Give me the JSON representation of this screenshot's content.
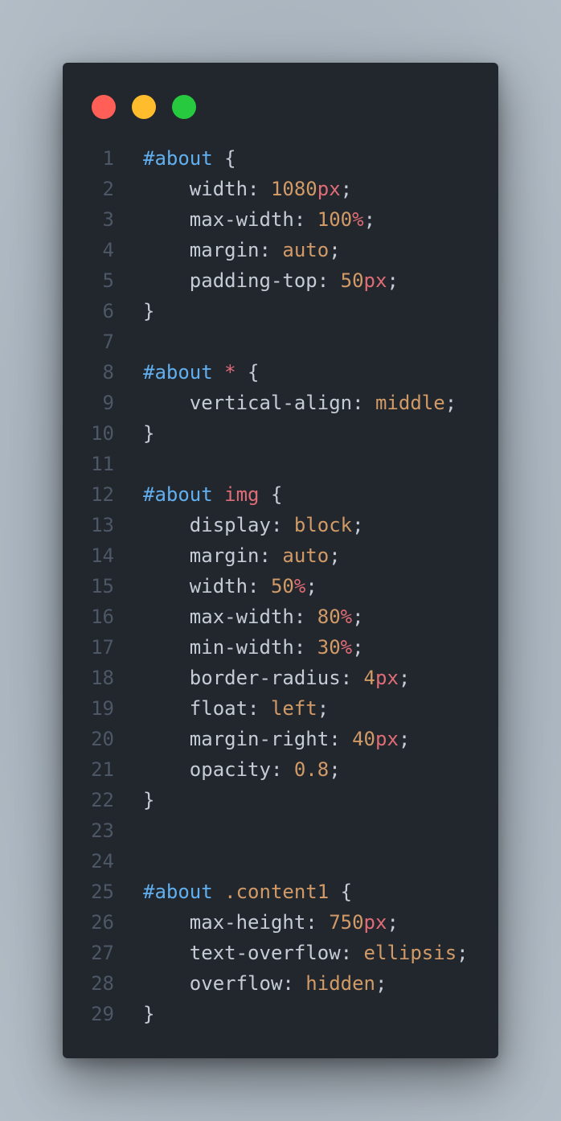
{
  "window": {
    "controls": [
      {
        "name": "close",
        "color": "#ff5f56"
      },
      {
        "name": "minimize",
        "color": "#ffbd2e"
      },
      {
        "name": "maximize",
        "color": "#27c93f"
      }
    ]
  },
  "code": {
    "lines": [
      [
        {
          "t": "sel-id",
          "v": "#about"
        },
        {
          "t": "punc",
          "v": " {"
        }
      ],
      [
        {
          "t": "prop",
          "v": "    width: "
        },
        {
          "t": "num",
          "v": "1080"
        },
        {
          "t": "unit",
          "v": "px"
        },
        {
          "t": "punc",
          "v": ";"
        }
      ],
      [
        {
          "t": "prop",
          "v": "    max-width: "
        },
        {
          "t": "num",
          "v": "100"
        },
        {
          "t": "unit",
          "v": "%"
        },
        {
          "t": "punc",
          "v": ";"
        }
      ],
      [
        {
          "t": "prop",
          "v": "    margin: "
        },
        {
          "t": "kw",
          "v": "auto"
        },
        {
          "t": "punc",
          "v": ";"
        }
      ],
      [
        {
          "t": "prop",
          "v": "    padding-top: "
        },
        {
          "t": "num",
          "v": "50"
        },
        {
          "t": "unit",
          "v": "px"
        },
        {
          "t": "punc",
          "v": ";"
        }
      ],
      [
        {
          "t": "punc",
          "v": "}"
        }
      ],
      [],
      [
        {
          "t": "sel-id",
          "v": "#about"
        },
        {
          "t": "punc",
          "v": " "
        },
        {
          "t": "sel-star",
          "v": "*"
        },
        {
          "t": "punc",
          "v": " {"
        }
      ],
      [
        {
          "t": "prop",
          "v": "    vertical-align: "
        },
        {
          "t": "kw",
          "v": "middle"
        },
        {
          "t": "punc",
          "v": ";"
        }
      ],
      [
        {
          "t": "punc",
          "v": "}"
        }
      ],
      [],
      [
        {
          "t": "sel-id",
          "v": "#about"
        },
        {
          "t": "punc",
          "v": " "
        },
        {
          "t": "sel-tag",
          "v": "img"
        },
        {
          "t": "punc",
          "v": " {"
        }
      ],
      [
        {
          "t": "prop",
          "v": "    display: "
        },
        {
          "t": "kw",
          "v": "block"
        },
        {
          "t": "punc",
          "v": ";"
        }
      ],
      [
        {
          "t": "prop",
          "v": "    margin: "
        },
        {
          "t": "kw",
          "v": "auto"
        },
        {
          "t": "punc",
          "v": ";"
        }
      ],
      [
        {
          "t": "prop",
          "v": "    width: "
        },
        {
          "t": "num",
          "v": "50"
        },
        {
          "t": "unit",
          "v": "%"
        },
        {
          "t": "punc",
          "v": ";"
        }
      ],
      [
        {
          "t": "prop",
          "v": "    max-width: "
        },
        {
          "t": "num",
          "v": "80"
        },
        {
          "t": "unit",
          "v": "%"
        },
        {
          "t": "punc",
          "v": ";"
        }
      ],
      [
        {
          "t": "prop",
          "v": "    min-width: "
        },
        {
          "t": "num",
          "v": "30"
        },
        {
          "t": "unit",
          "v": "%"
        },
        {
          "t": "punc",
          "v": ";"
        }
      ],
      [
        {
          "t": "prop",
          "v": "    border-radius: "
        },
        {
          "t": "num",
          "v": "4"
        },
        {
          "t": "unit",
          "v": "px"
        },
        {
          "t": "punc",
          "v": ";"
        }
      ],
      [
        {
          "t": "prop",
          "v": "    float: "
        },
        {
          "t": "kw",
          "v": "left"
        },
        {
          "t": "punc",
          "v": ";"
        }
      ],
      [
        {
          "t": "prop",
          "v": "    margin-right: "
        },
        {
          "t": "num",
          "v": "40"
        },
        {
          "t": "unit",
          "v": "px"
        },
        {
          "t": "punc",
          "v": ";"
        }
      ],
      [
        {
          "t": "prop",
          "v": "    opacity: "
        },
        {
          "t": "num",
          "v": "0.8"
        },
        {
          "t": "punc",
          "v": ";"
        }
      ],
      [
        {
          "t": "punc",
          "v": "}"
        }
      ],
      [],
      [],
      [
        {
          "t": "sel-id",
          "v": "#about"
        },
        {
          "t": "punc",
          "v": " "
        },
        {
          "t": "sel-class",
          "v": ".content1"
        },
        {
          "t": "punc",
          "v": " {"
        }
      ],
      [
        {
          "t": "prop",
          "v": "    max-height: "
        },
        {
          "t": "num",
          "v": "750"
        },
        {
          "t": "unit",
          "v": "px"
        },
        {
          "t": "punc",
          "v": ";"
        }
      ],
      [
        {
          "t": "prop",
          "v": "    text-overflow: "
        },
        {
          "t": "kw",
          "v": "ellipsis"
        },
        {
          "t": "punc",
          "v": ";"
        }
      ],
      [
        {
          "t": "prop",
          "v": "    overflow: "
        },
        {
          "t": "kw",
          "v": "hidden"
        },
        {
          "t": "punc",
          "v": ";"
        }
      ],
      [
        {
          "t": "punc",
          "v": "}"
        }
      ]
    ]
  }
}
